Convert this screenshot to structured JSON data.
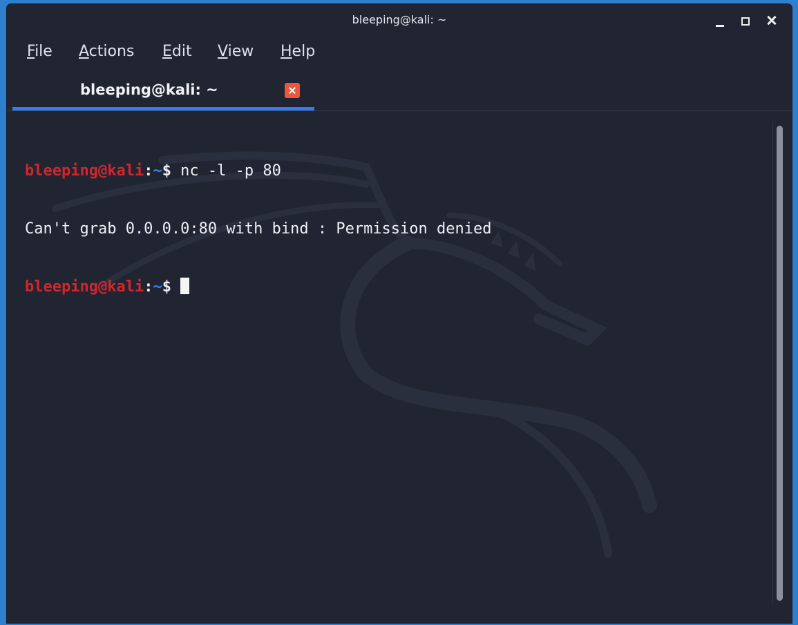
{
  "window": {
    "title": "bleeping@kali: ~"
  },
  "menu": {
    "items": [
      {
        "accel": "F",
        "rest": "ile"
      },
      {
        "accel": "A",
        "rest": "ctions"
      },
      {
        "accel": "E",
        "rest": "dit"
      },
      {
        "accel": "V",
        "rest": "iew"
      },
      {
        "accel": "H",
        "rest": "elp"
      }
    ]
  },
  "tab": {
    "label": "bleeping@kali: ~"
  },
  "terminal": {
    "lines": [
      {
        "user": "bleeping@kali",
        "sep": ":",
        "path": "~",
        "dollar": "$",
        "command": " nc -l -p 80"
      },
      {
        "output": "Can't grab 0.0.0.0:80 with bind : Permission denied"
      },
      {
        "user": "bleeping@kali",
        "sep": ":",
        "path": "~",
        "dollar": "$",
        "command": " "
      }
    ]
  },
  "colors": {
    "background": "#212531",
    "prompt_user": "#d2262e",
    "prompt_path": "#3b82e6",
    "tab_indicator": "#367bf0",
    "tab_close": "#e8583f",
    "desktop": "#2f7fcf"
  },
  "icons": {
    "minimize": "minimize-icon",
    "maximize": "maximize-icon",
    "close": "close-icon",
    "tab_close": "tab-close-icon",
    "watermark": "kali-dragon-watermark"
  }
}
